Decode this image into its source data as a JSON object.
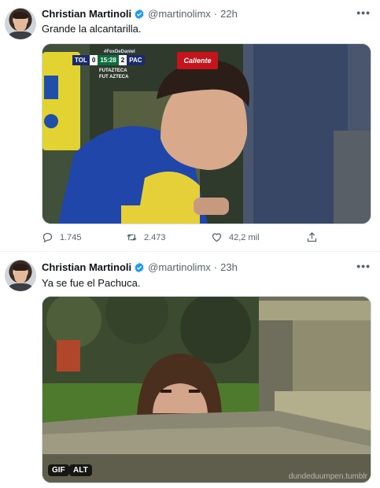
{
  "tweets": [
    {
      "author_name": "Christian Martinoli",
      "handle": "@martinolimx",
      "separator": "·",
      "time": "22h",
      "text": "Grande la alcantarilla.",
      "media": {
        "scoreboard": {
          "hashtag": "#FoxDeDaniel",
          "home": "TOL",
          "home_score": "0",
          "clock": "15:28",
          "away_score": "2",
          "away": "PAC",
          "sponsor": "Caliente",
          "network_line1": "FUTAZTECA",
          "network_line2": "FUT AZTECA"
        }
      },
      "stats": {
        "replies": "1.745",
        "retweets": "2.473",
        "likes": "42,2 mil"
      }
    },
    {
      "author_name": "Christian Martinoli",
      "handle": "@martinolimx",
      "separator": "·",
      "time": "23h",
      "text": "Ya se fue el Pachuca.",
      "media": {
        "gif_badge": "GIF",
        "alt_badge": "ALT",
        "watermark": "dundeduumpen.tumblr"
      }
    }
  ],
  "icons": {
    "verified": "verified-badge-icon",
    "more": "more-horizontal-icon",
    "reply": "reply-icon",
    "retweet": "retweet-icon",
    "like": "like-heart-icon",
    "share": "share-icon"
  },
  "colors": {
    "verified_blue": "#1d9bf0",
    "secondary_text": "#536471",
    "border": "#cfd9de"
  }
}
